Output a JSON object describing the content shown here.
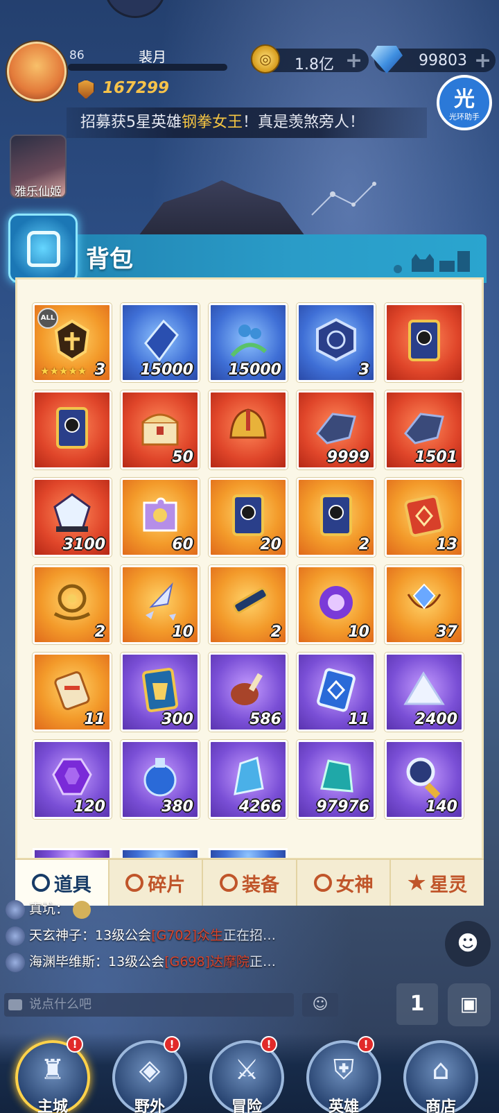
{
  "player": {
    "level": "86",
    "name": "裴月",
    "power": "167299"
  },
  "resources": {
    "gold": "1.8亿",
    "diamonds": "99803",
    "plus": "+"
  },
  "helper": {
    "glyph": "光",
    "label": "光环助手"
  },
  "ticker": {
    "prefix": "招募获5星英雄",
    "hero": "钢拳女王",
    "suffix": "！真是羡煞旁人！"
  },
  "side_hero": {
    "label": "雅乐仙姬"
  },
  "backpack": {
    "title": "背包",
    "items": [
      {
        "count": "3",
        "bg": "orange",
        "icon": "all-hero-soul-icon",
        "all": "ALL",
        "stars": "★★★★★"
      },
      {
        "count": "15000",
        "bg": "blue",
        "icon": "crystal-shard-icon"
      },
      {
        "count": "15000",
        "bg": "blue",
        "icon": "herb-icon"
      },
      {
        "count": "3",
        "bg": "blue",
        "icon": "rune-hexagon-icon"
      },
      {
        "count": "",
        "bg": "red",
        "icon": "hero-card-icon"
      },
      {
        "count": "",
        "bg": "red",
        "icon": "hero-card-icon"
      },
      {
        "count": "50",
        "bg": "red",
        "icon": "treasure-chest-icon"
      },
      {
        "count": "",
        "bg": "red",
        "icon": "golden-helmet-icon"
      },
      {
        "count": "9999",
        "bg": "red",
        "icon": "dark-crystal-icon"
      },
      {
        "count": "1501",
        "bg": "red",
        "icon": "dark-crystal-icon"
      },
      {
        "count": "3100",
        "bg": "red",
        "icon": "prism-gem-icon"
      },
      {
        "count": "60",
        "bg": "orange",
        "icon": "puzzle-piece-icon"
      },
      {
        "count": "20",
        "bg": "orange",
        "icon": "hero-card-icon"
      },
      {
        "count": "2",
        "bg": "orange",
        "icon": "hero-card-icon"
      },
      {
        "count": "13",
        "bg": "orange",
        "icon": "red-card-icon"
      },
      {
        "count": "2",
        "bg": "orange",
        "icon": "compass-icon"
      },
      {
        "count": "10",
        "bg": "orange",
        "icon": "crystal-fragments-icon"
      },
      {
        "count": "2",
        "bg": "orange",
        "icon": "telescope-icon"
      },
      {
        "count": "10",
        "bg": "orange",
        "icon": "void-orb-icon"
      },
      {
        "count": "37",
        "bg": "orange",
        "icon": "gem-pendant-icon"
      },
      {
        "count": "11",
        "bg": "orange",
        "icon": "scroll-icon"
      },
      {
        "count": "300",
        "bg": "purple",
        "icon": "armor-card-icon"
      },
      {
        "count": "586",
        "bg": "purple",
        "icon": "meat-icon"
      },
      {
        "count": "11",
        "bg": "purple",
        "icon": "blue-card-icon"
      },
      {
        "count": "2400",
        "bg": "purple",
        "icon": "salt-crystal-icon"
      },
      {
        "count": "120",
        "bg": "purple",
        "icon": "purple-gem-icon"
      },
      {
        "count": "380",
        "bg": "purple",
        "icon": "potion-icon"
      },
      {
        "count": "4266",
        "bg": "purple",
        "icon": "ice-crystal-icon"
      },
      {
        "count": "97976",
        "bg": "purple",
        "icon": "teal-crystal-icon"
      },
      {
        "count": "140",
        "bg": "purple",
        "icon": "magnifier-icon"
      }
    ],
    "tabs": [
      {
        "label": "道具",
        "icon": "props-icon",
        "active": true
      },
      {
        "label": "碎片",
        "icon": "fragment-icon",
        "active": false
      },
      {
        "label": "装备",
        "icon": "equipment-icon",
        "active": false
      },
      {
        "label": "女神",
        "icon": "goddess-icon",
        "active": false
      },
      {
        "label": "星灵",
        "icon": "star-spirit-icon",
        "active": false
      }
    ]
  },
  "chat": {
    "lines": [
      {
        "name": "真坑：",
        "guild": "",
        "rest": ""
      },
      {
        "name": "天玄神子：13级公会",
        "guild": "[G702]众生",
        "rest": "正在招…"
      },
      {
        "name": "海渊毕维斯：13级公会",
        "guild": "[G698]达摩院",
        "rest": "正…"
      }
    ],
    "placeholder": "说点什么吧",
    "rank_glyph": "1"
  },
  "nav": [
    {
      "label": "主城",
      "icon": "castle-icon",
      "badge": "!"
    },
    {
      "label": "野外",
      "icon": "wild-gate-icon",
      "badge": "!"
    },
    {
      "label": "冒险",
      "icon": "sword-icon",
      "badge": "!"
    },
    {
      "label": "英雄",
      "icon": "knight-helmet-icon",
      "badge": "!"
    },
    {
      "label": "商店",
      "icon": "shop-icon",
      "badge": ""
    }
  ],
  "colors": {
    "accent_gold": "#f6c24a",
    "ticker_highlight": "#f5c542",
    "guild_red": "#d9442c",
    "tab_active": "#173b66",
    "tab_inactive": "#c0552a"
  }
}
